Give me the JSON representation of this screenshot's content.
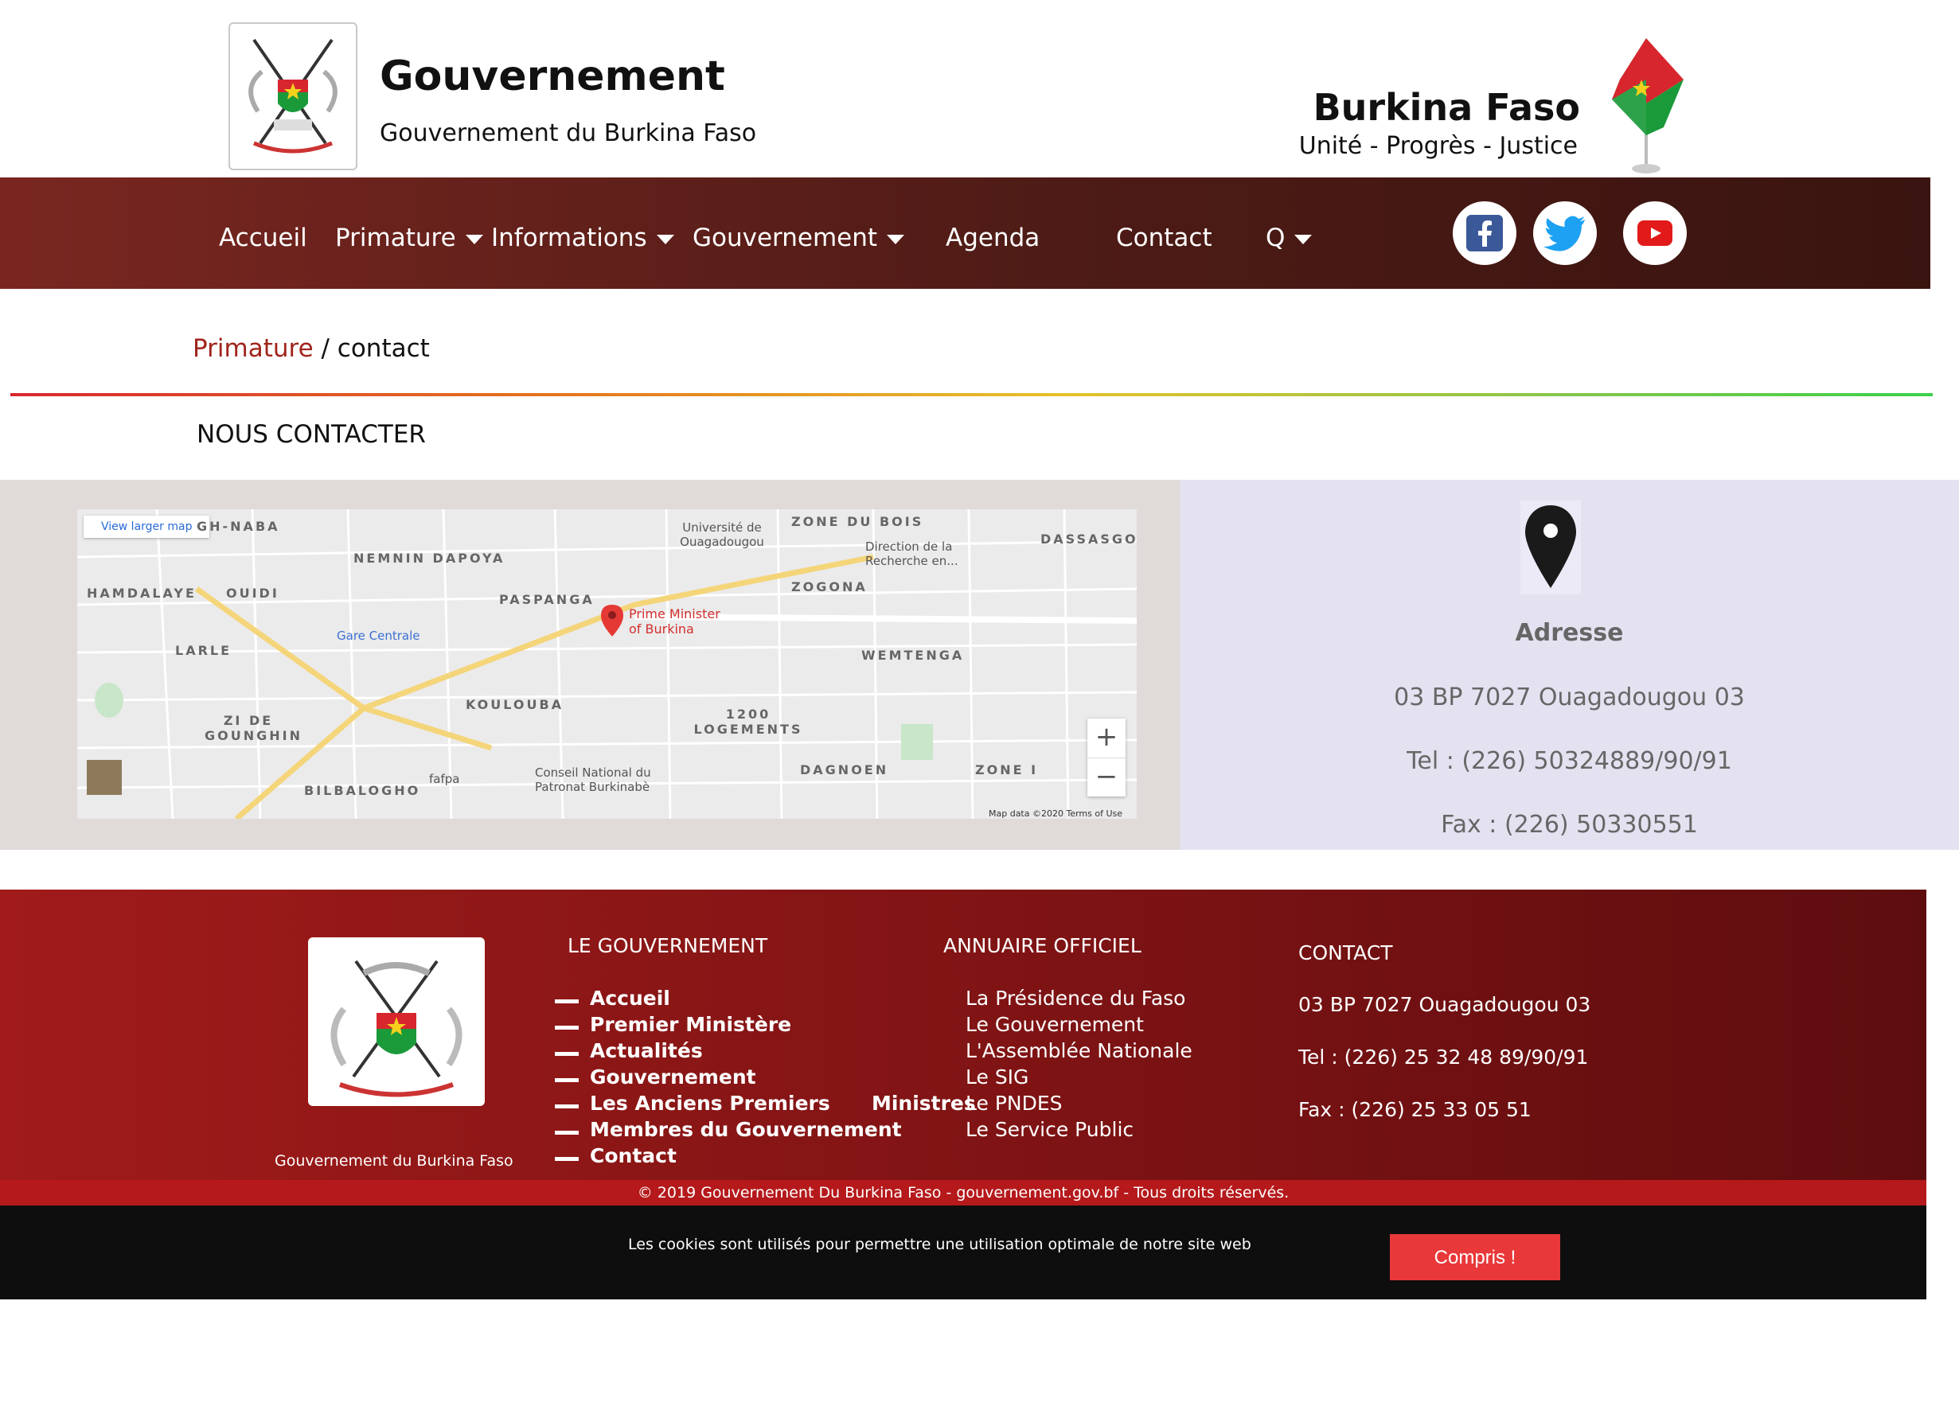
{
  "header": {
    "title": "Gouvernement",
    "subtitle": "Gouvernement du Burkina Faso",
    "country": "Burkina Faso",
    "motto": "Unité - Progrès - Justice"
  },
  "nav": {
    "items": [
      {
        "label": "Accueil",
        "dropdown": false
      },
      {
        "label": "Primature",
        "dropdown": true
      },
      {
        "label": "Informations",
        "dropdown": true
      },
      {
        "label": "Gouvernement",
        "dropdown": true
      },
      {
        "label": "Agenda",
        "dropdown": false
      },
      {
        "label": "Contact",
        "dropdown": false
      },
      {
        "label": "Q",
        "dropdown": true
      }
    ],
    "social": [
      "facebook-icon",
      "twitter-icon",
      "youtube-icon"
    ]
  },
  "breadcrumb": {
    "parent": "Primature",
    "separator": " / ",
    "current": "contact"
  },
  "section_title": "NOUS CONTACTER",
  "map": {
    "view_larger": "View larger map",
    "districts": [
      "GH-NABA",
      "NEMNIN DAPOYA",
      "HAMDALAYE",
      "OUIDI",
      "PASPANGA",
      "LARLE",
      "ZONE DU BOIS",
      "ZOGONA",
      "DASSASGO",
      "WEMTENGA",
      "KOULOUBA",
      "ZI DE GOUNGHIN",
      "1200 LOGEMENTS",
      "DAGNOEN",
      "ZONE I",
      "BILBALOGHO"
    ],
    "pois": [
      "Université de Ouagadougou",
      "Direction de la Recherche en...",
      "Gare Centrale",
      "Conseil National du Patronat Burkinabè",
      "fafpa"
    ],
    "marker": "Prime Minister of Burkina",
    "zoom_in": "+",
    "zoom_out": "−",
    "credit": "Map data ©2020   Terms of Use"
  },
  "address": {
    "heading": "Adresse",
    "lines": [
      "03 BP 7027 Ouagadougou 03",
      "Tel : (226) 50324889/90/91",
      "Fax : (226) 50330551"
    ]
  },
  "footer": {
    "caption": "Gouvernement du Burkina Faso",
    "gov_title": "LE GOUVERNEMENT",
    "gov_links": [
      "Accueil",
      "Premier Ministère",
      "Actualités",
      "Gouvernement",
      "Les Anciens Premiers      Ministres",
      "Membres du Gouvernement",
      "Contact"
    ],
    "annuaire_title": "ANNUAIRE OFFICIEL",
    "annuaire_links": [
      "La Présidence du Faso",
      "Le Gouvernement",
      "L'Assemblée Nationale",
      "Le SIG",
      "Le PNDES",
      "Le Service Public"
    ],
    "contact_title": "CONTACT",
    "contact_lines": [
      "03 BP 7027 Ouagadougou 03",
      "Tel : (226) 25 32 48 89/90/91",
      "Fax : (226) 25 33 05 51"
    ]
  },
  "copyright": "© 2019 Gouvernement Du Burkina Faso - gouvernement.gov.bf - Tous droits réservés.",
  "cookie": {
    "text": "Les cookies sont utilisés pour permettre une utilisation optimale de notre site web",
    "button": "Compris !"
  },
  "colors": {
    "nav": "#5a1e19",
    "footer": "#8a1416",
    "accent": "#a0241c",
    "cookie_button": "#e8383a"
  }
}
